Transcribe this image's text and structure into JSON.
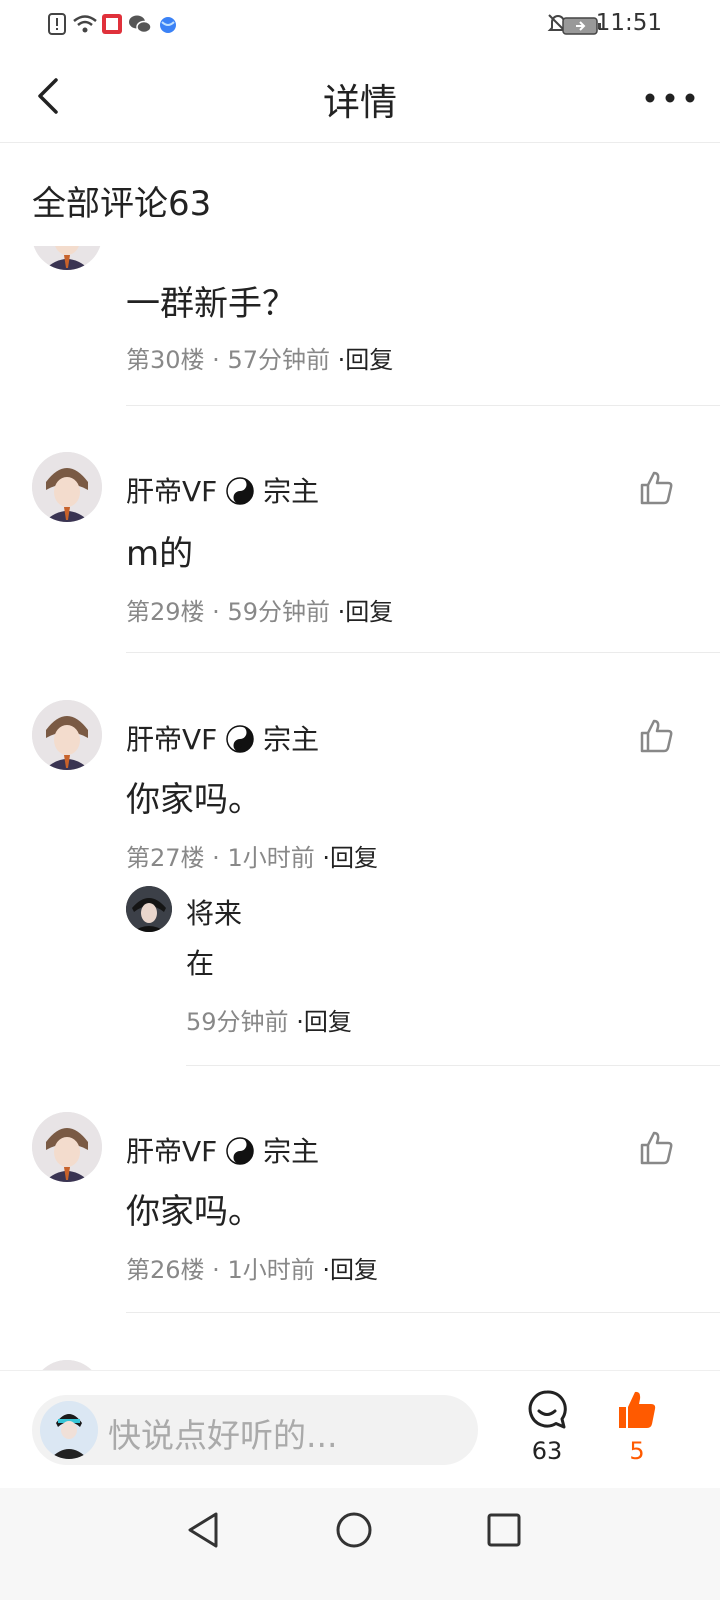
{
  "status_bar": {
    "time": "11:51"
  },
  "header": {
    "title": "详情"
  },
  "section": {
    "title": "全部评论63"
  },
  "comments": [
    {
      "name": "",
      "text": "一群新手？",
      "floor": "第30楼",
      "time": "57分钟前",
      "reply_label": "·回复"
    },
    {
      "name": "肝帝VF",
      "name_suffix": "宗主",
      "text": "m的",
      "floor": "第29楼",
      "time": "59分钟前",
      "reply_label": "·回复"
    },
    {
      "name": "肝帝VF",
      "name_suffix": "宗主",
      "text": "你家吗。",
      "floor": "第27楼",
      "time": "1小时前",
      "reply_label": "·回复",
      "sub_reply": {
        "name": "将来",
        "text": "在",
        "time": "59分钟前",
        "reply_label": "·回复"
      }
    },
    {
      "name": "肝帝VF",
      "name_suffix": "宗主",
      "text": "你家吗。",
      "floor": "第26楼",
      "time": "1小时前",
      "reply_label": "·回复"
    }
  ],
  "meta_separator": " · ",
  "input_bar": {
    "placeholder": "快说点好听的...",
    "comment_count": "63",
    "like_count": "5"
  },
  "colors": {
    "accent_orange": "#ff5a00",
    "meta_gray": "#888888"
  },
  "icons": [
    "back-icon",
    "more-icon",
    "like-icon",
    "comment-icon",
    "thumbs-up-filled-icon",
    "nav-back-icon",
    "nav-home-icon",
    "nav-recents-icon"
  ]
}
